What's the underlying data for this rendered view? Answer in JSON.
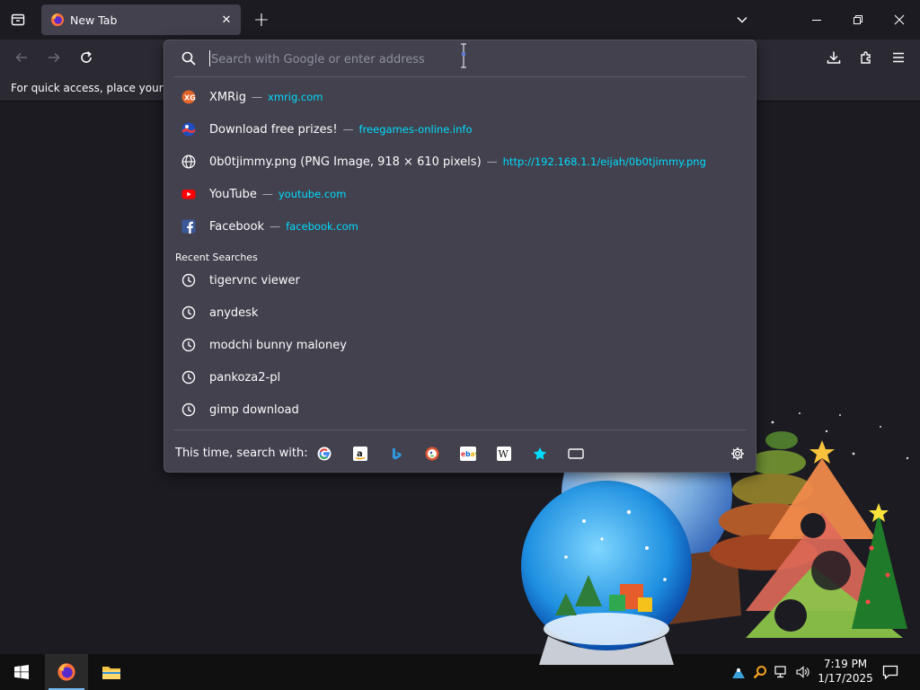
{
  "tab": {
    "title": "New Tab"
  },
  "bookmarks_bar": {
    "text": "For quick access, place your boo"
  },
  "urlbar": {
    "placeholder": "Search with Google or enter address",
    "suggestions": [
      {
        "icon": "xmrig-favicon",
        "title": "XMRig",
        "url": "xmrig.com"
      },
      {
        "icon": "globe-flag-favicon",
        "title": "Download free prizes!",
        "url": "freegames-online.info"
      },
      {
        "icon": "globe-icon",
        "title": "0b0tjimmy.png (PNG Image, 918 × 610 pixels)",
        "url": "http://192.168.1.1/eijah/0b0tjimmy.png"
      },
      {
        "icon": "youtube-favicon",
        "title": "YouTube",
        "url": "youtube.com"
      },
      {
        "icon": "facebook-favicon",
        "title": "Facebook",
        "url": "facebook.com"
      }
    ],
    "dash": "—",
    "recent_label": "Recent Searches",
    "recent": [
      "tigervnc viewer",
      "anydesk",
      "modchi bunny maloney",
      "pankoza2-pl",
      "gimp download"
    ],
    "footer_label": "This time, search with:",
    "engines": [
      "google-icon",
      "amazon-icon",
      "bing-icon",
      "duckduckgo-icon",
      "ebay-icon",
      "wikipedia-icon",
      "bookmarks-star-icon",
      "tabs-icon"
    ]
  },
  "taskbar": {
    "time": "7:19 PM",
    "date": "1/17/2025"
  },
  "colors": {
    "accent_url": "#00ddff",
    "panel": "#42414d",
    "toolbar": "#2b2a33",
    "background": "#1c1b22"
  }
}
